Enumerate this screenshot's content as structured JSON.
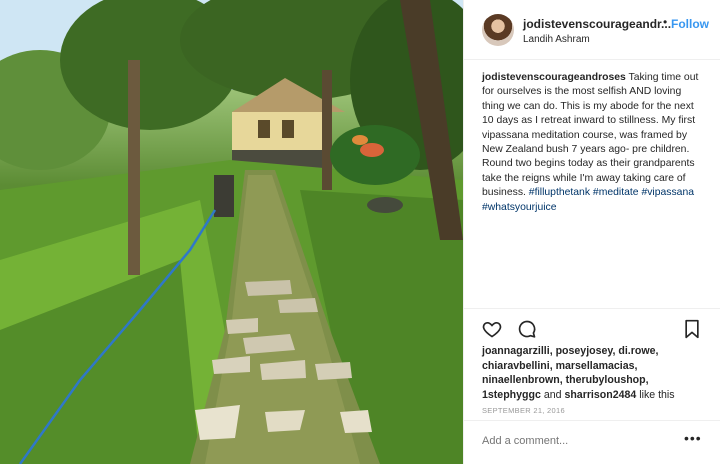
{
  "header": {
    "username": "jodistevenscourageandr...",
    "dot": "•",
    "follow_label": "Follow",
    "location": "Landih Ashram"
  },
  "caption": {
    "username": "jodistevenscourageandroses",
    "text": " Taking time out for ourselves is the most selfish AND loving thing we can do. This is my abode for the next 10 days as I retreat inward to stillness. My first vipassana meditation course, was framed by New Zealand bush 7 years ago- pre children. Round two begins today as their grandparents take the reigns while I'm away taking care of business.",
    "hashtags": [
      "#fillupthetank",
      "#meditate",
      "#vipassana",
      "#whatsyourjuice"
    ]
  },
  "likes": {
    "names": "joannagarzilli, poseyjosey, di.rowe, chiaravbellini, marsellamacias, ninaellenbrown, therubyloushop, 1stephyggc",
    "and": " and ",
    "last": "sharrison2484",
    "suffix": " like this"
  },
  "date": "SEPTEMBER 21, 2016",
  "comment": {
    "placeholder": "Add a comment..."
  },
  "more_label": "•••",
  "icons": [
    "heart-icon",
    "comment-icon",
    "bookmark-icon"
  ],
  "colors": {
    "link": "#3897f0",
    "hashtag": "#003569",
    "muted": "#999999"
  }
}
